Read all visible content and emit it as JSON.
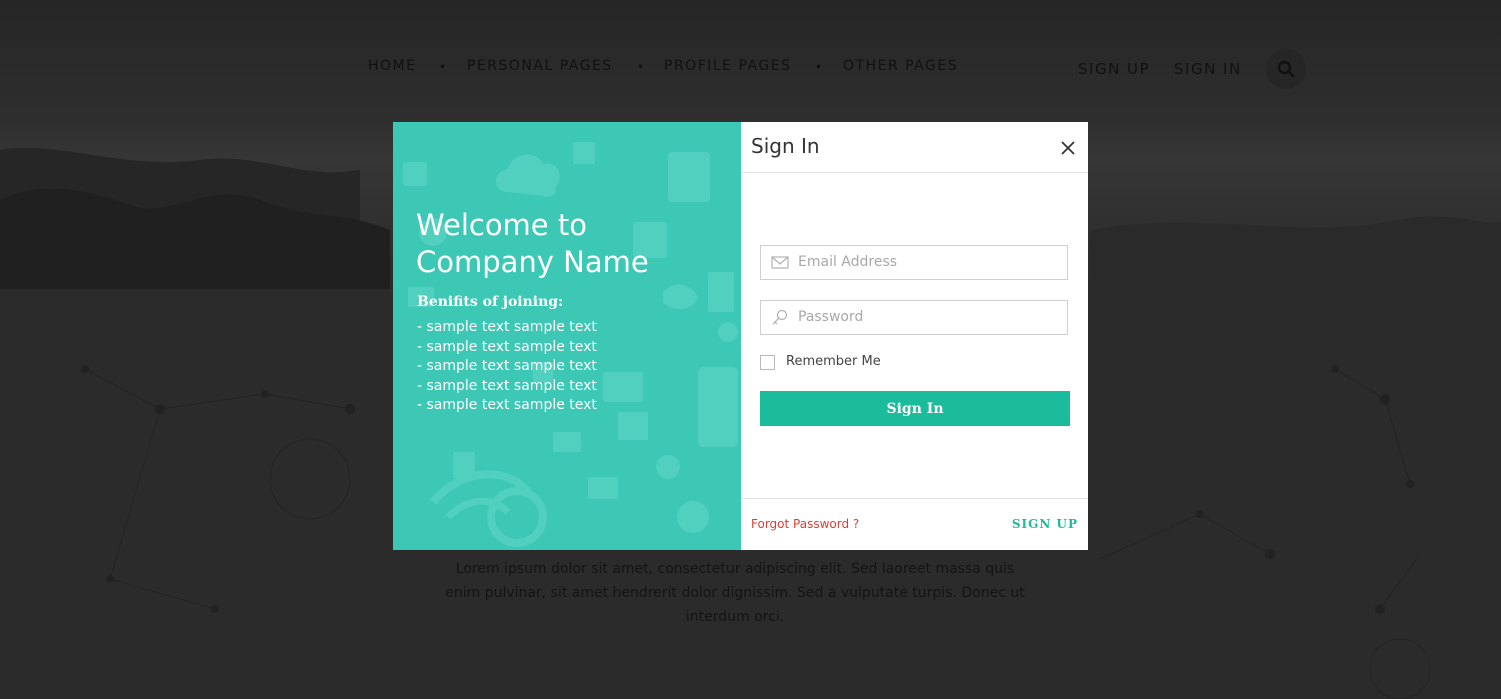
{
  "nav": {
    "items": [
      {
        "label": "HOME"
      },
      {
        "label": "PERSONAL PAGES"
      },
      {
        "label": "PROFILE PAGES"
      },
      {
        "label": "OTHER PAGES"
      }
    ],
    "sign_up": "SIGN UP",
    "sign_in": "SIGN IN",
    "search_icon": "search-icon"
  },
  "background": {
    "paragraph_lines": [
      "Lorem ipsum dolor sit amet, consectetur adipiscing elit. Sed laoreet massa quis",
      "enim pulvinar, sit amet hendrerit dolor dignissim. Sed a vulputate turpis. Donec ut",
      "interdum orci."
    ]
  },
  "modal": {
    "welcome_line1": "Welcome to",
    "welcome_line2": "Company Name",
    "benefits_title": "Benifits of joining:",
    "benefits": [
      "- sample text sample text",
      "- sample text sample text",
      "- sample text sample text",
      "- sample text sample text",
      "- sample text sample text"
    ],
    "title": "Sign In",
    "close_icon": "close-icon",
    "email": {
      "placeholder": "Email Address",
      "value": "",
      "icon": "envelope-icon"
    },
    "password": {
      "placeholder": "Password",
      "value": "",
      "icon": "key-icon"
    },
    "remember_label": "Remember Me",
    "remember_checked": false,
    "submit_label": "Sign In",
    "forgot_label": "Forgot Password ?",
    "signup_label": "SIGN UP"
  },
  "colors": {
    "accent": "#1bbc9b",
    "left_panel": "#3cc8b5",
    "link_red": "#e03c31",
    "overlay": "#2c2c2c"
  }
}
